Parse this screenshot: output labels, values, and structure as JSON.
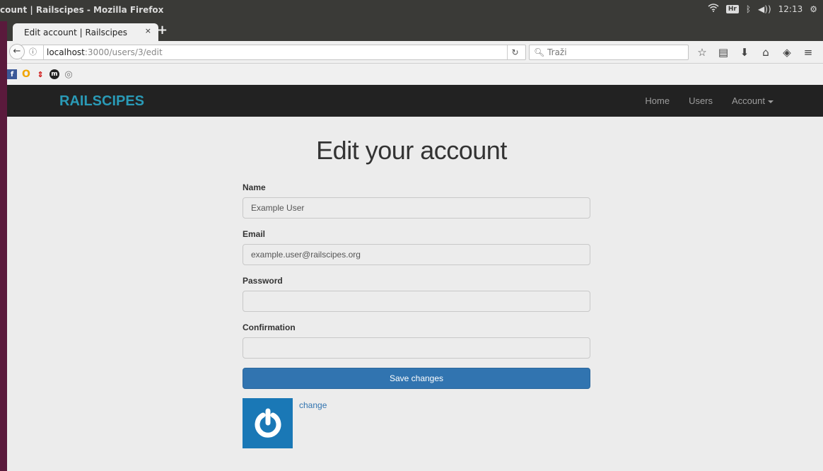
{
  "os": {
    "window_title": "count | Railscipes - Mozilla Firefox",
    "hr_badge": "Hr",
    "time": "12:13"
  },
  "browser": {
    "tab_title": "Edit account | Railscipes",
    "tab_close": "×",
    "new_tab": "+",
    "url_host": "localhost",
    "url_path": ":3000/users/3/edit",
    "search_placeholder": "Traži"
  },
  "site": {
    "brand": "RAILSCIPES",
    "brand_color": "#2a9ab6",
    "nav": {
      "home": "Home",
      "users": "Users",
      "account": "Account"
    },
    "page_title": "Edit your account",
    "form": {
      "name_label": "Name",
      "name_value": "Example User",
      "email_label": "Email",
      "email_value": "example.user@railscipes.org",
      "password_label": "Password",
      "password_value": "",
      "confirmation_label": "Confirmation",
      "confirmation_value": "",
      "save_label": "Save changes",
      "save_color": "#3174b0"
    },
    "gravatar_change": "change"
  }
}
